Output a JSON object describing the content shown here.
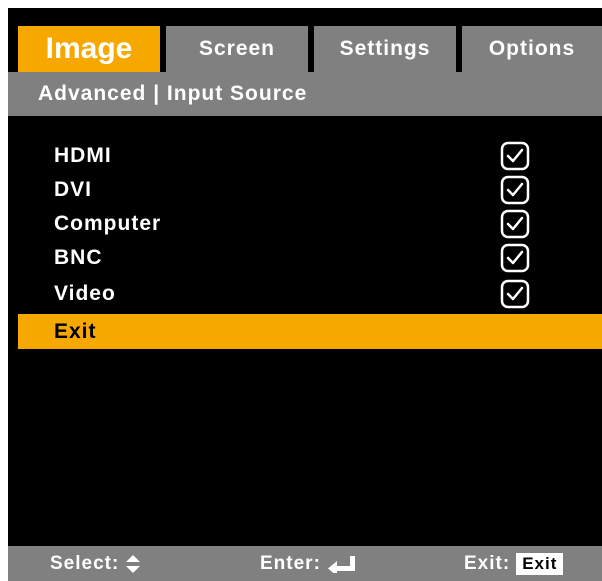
{
  "tabs": [
    {
      "label": "Image",
      "active": true
    },
    {
      "label": "Screen",
      "active": false
    },
    {
      "label": "Settings",
      "active": false
    },
    {
      "label": "Options",
      "active": false
    }
  ],
  "breadcrumb": "Advanced | Input Source",
  "sources": [
    {
      "label": "HDMI",
      "checked": true
    },
    {
      "label": "DVI",
      "checked": true
    },
    {
      "label": "Computer",
      "checked": true
    },
    {
      "label": "BNC",
      "checked": true
    },
    {
      "label": "Video",
      "checked": true
    }
  ],
  "exit_item": "Exit",
  "footer": {
    "select_label": "Select:",
    "enter_label": "Enter:",
    "exit_label": "Exit:",
    "exit_key": "Exit"
  },
  "colors": {
    "accent": "#f7a800",
    "bar_gray": "#808080",
    "background": "#000000"
  },
  "icons": {
    "select": "up-down-arrows-icon",
    "enter": "enter-key-icon",
    "check": "checkbox-checked-icon"
  }
}
